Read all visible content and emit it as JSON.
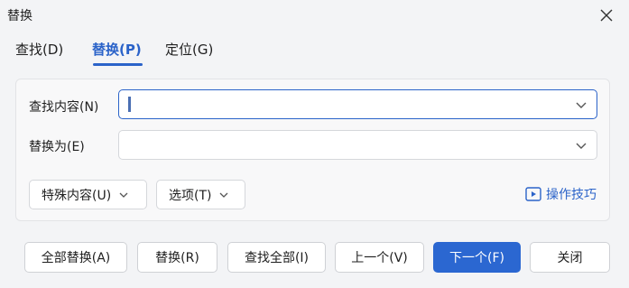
{
  "window": {
    "title": "替换"
  },
  "tabs": [
    {
      "label": "查找(D)"
    },
    {
      "label": "替换(P)"
    },
    {
      "label": "定位(G)"
    }
  ],
  "find": {
    "label": "查找内容(N)",
    "value": ""
  },
  "replace": {
    "label": "替换为(E)",
    "value": ""
  },
  "options": {
    "special_label": "特殊内容(U)",
    "options_label": "选项(T)",
    "tips_label": "操作技巧"
  },
  "buttons": {
    "replace_all": "全部替换(A)",
    "replace": "替换(R)",
    "find_all": "查找全部(I)",
    "prev": "上一个(V)",
    "next": "下一个(F)",
    "close": "关闭"
  },
  "colors": {
    "accent": "#2b63c9",
    "primary_button": "#2b67d1"
  }
}
